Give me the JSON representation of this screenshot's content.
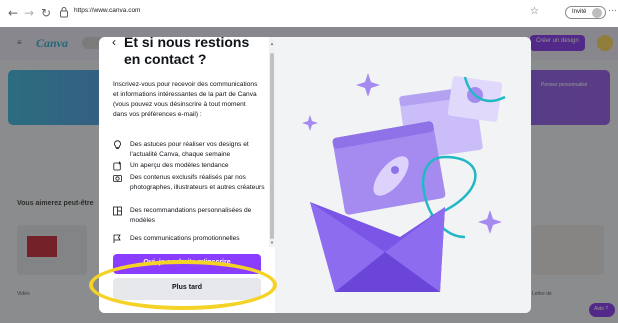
{
  "browser": {
    "url": "https://www.canva.com",
    "invite_label": "Invité",
    "icons": [
      "back-arrow-icon",
      "forward-arrow-icon",
      "reload-icon",
      "lock-icon",
      "star-icon",
      "more-icon"
    ],
    "back_glyph": "←",
    "forward_glyph": "→",
    "reload_glyph": "↻",
    "star_glyph": "☆",
    "more_glyph": "···"
  },
  "background_page": {
    "logo": "Canva",
    "hamburger_glyph": "≡",
    "create_button_label": "Créer un design",
    "banner_text": "Pensez personnalisé",
    "section_title": "Vous aimerez peut-être",
    "thumb_label_left": "Vidéo",
    "thumb_label_right": "Lettre de",
    "help_label": "Aide ?"
  },
  "modal": {
    "back_glyph": "‹",
    "title": "Et si nous restions en contact ?",
    "intro": "Inscrivez-vous pour recevoir des communications et informations intéressantes de la part de Canva (vous pouvez vous désinscrire à tout moment dans vos préférences e-mail) :",
    "bullets": [
      {
        "icon": "lightbulb-icon",
        "glyph": "💡",
        "text": "Des astuces pour réaliser vos designs et l'actualité Canva, chaque semaine"
      },
      {
        "icon": "sparkle-plus-icon",
        "glyph": "✚",
        "text": "Un aperçu des modèles tendance"
      },
      {
        "icon": "camera-icon",
        "glyph": "◎",
        "text": "Des contenus exclusifs réalisés par nos photographes, illustrateurs et autres créateurs"
      },
      {
        "icon": "template-icon",
        "glyph": "▦",
        "text": "Des recommandations personnalisées de modèles"
      },
      {
        "icon": "flag-icon",
        "glyph": "⚑",
        "text": "Des communications promotionnelles"
      }
    ],
    "primary_button": "Oui, je souhaite m'inscrire",
    "secondary_button": "Plus tard"
  },
  "colors": {
    "accent": "#8b3dff",
    "highlight": "#f5d226",
    "illustration_purple": "#a58bf0",
    "illustration_teal": "#21b8c6"
  }
}
